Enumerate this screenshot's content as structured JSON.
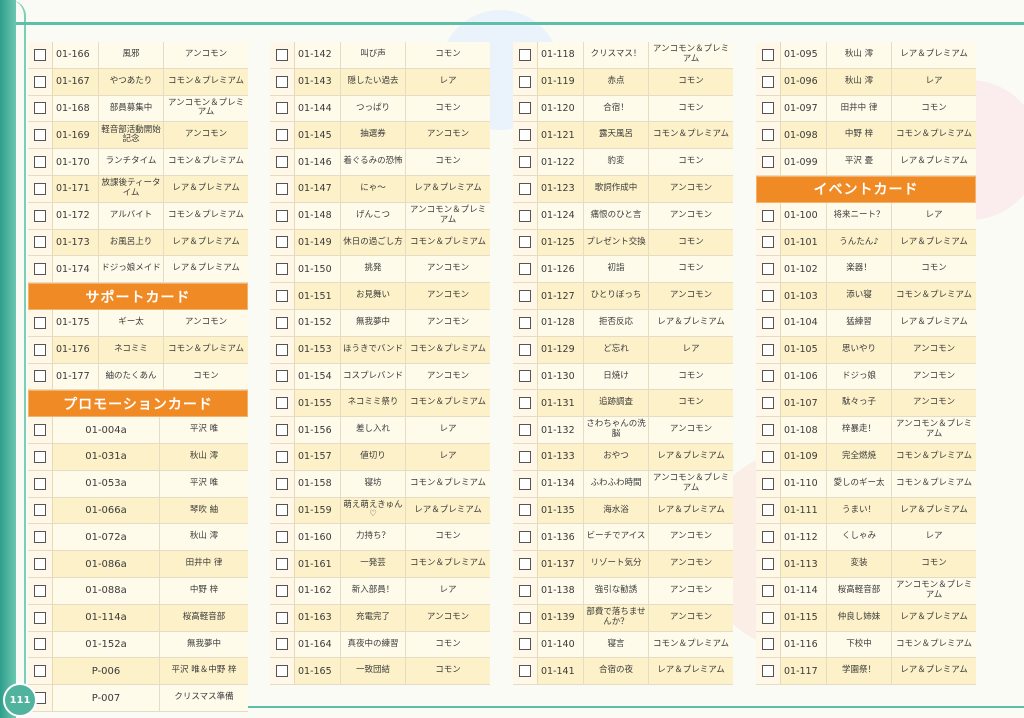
{
  "page_number": "111",
  "sections": {
    "support": "サポートカード",
    "promo": "プロモーションカード",
    "event": "イベントカード"
  },
  "col1": [
    {
      "num": "01-166",
      "name": "風邪",
      "rarity": "アンコモン"
    },
    {
      "num": "01-167",
      "name": "やつあたり",
      "rarity": "コモン＆プレミアム"
    },
    {
      "num": "01-168",
      "name": "部員募集中",
      "rarity": "アンコモン＆プレミアム"
    },
    {
      "num": "01-169",
      "name": "軽音部活動開始記念",
      "rarity": "アンコモン"
    },
    {
      "num": "01-170",
      "name": "ランチタイム",
      "rarity": "コモン＆プレミアム"
    },
    {
      "num": "01-171",
      "name": "放課後ティータイム",
      "rarity": "レア＆プレミアム"
    },
    {
      "num": "01-172",
      "name": "アルバイト",
      "rarity": "コモン＆プレミアム"
    },
    {
      "num": "01-173",
      "name": "お風呂上り",
      "rarity": "レア＆プレミアム"
    },
    {
      "num": "01-174",
      "name": "ドジっ娘メイド",
      "rarity": "レア＆プレミアム"
    }
  ],
  "col1_support": [
    {
      "num": "01-175",
      "name": "ギー太",
      "rarity": "アンコモン"
    },
    {
      "num": "01-176",
      "name": "ネコミミ",
      "rarity": "コモン＆プレミアム"
    },
    {
      "num": "01-177",
      "name": "紬のたくあん",
      "rarity": "コモン"
    }
  ],
  "col1_promo": [
    {
      "num": "01-004a",
      "name": "平沢 唯"
    },
    {
      "num": "01-031a",
      "name": "秋山 澪"
    },
    {
      "num": "01-053a",
      "name": "平沢 唯"
    },
    {
      "num": "01-066a",
      "name": "琴吹 紬"
    },
    {
      "num": "01-072a",
      "name": "秋山 澪"
    },
    {
      "num": "01-086a",
      "name": "田井中 律"
    },
    {
      "num": "01-088a",
      "name": "中野 梓"
    },
    {
      "num": "01-114a",
      "name": "桜高軽音部"
    },
    {
      "num": "01-152a",
      "name": "無我夢中"
    },
    {
      "num": "P-006",
      "name": "平沢 唯＆中野 梓"
    },
    {
      "num": "P-007",
      "name": "クリスマス準備"
    }
  ],
  "col2": [
    {
      "num": "01-142",
      "name": "叫び声",
      "rarity": "コモン"
    },
    {
      "num": "01-143",
      "name": "隠したい過去",
      "rarity": "レア"
    },
    {
      "num": "01-144",
      "name": "つっぱり",
      "rarity": "コモン"
    },
    {
      "num": "01-145",
      "name": "抽選券",
      "rarity": "アンコモン"
    },
    {
      "num": "01-146",
      "name": "着ぐるみの恐怖",
      "rarity": "コモン"
    },
    {
      "num": "01-147",
      "name": "にゃ～",
      "rarity": "レア＆プレミアム"
    },
    {
      "num": "01-148",
      "name": "げんこつ",
      "rarity": "アンコモン＆プレミアム"
    },
    {
      "num": "01-149",
      "name": "休日の過ごし方",
      "rarity": "コモン＆プレミアム"
    },
    {
      "num": "01-150",
      "name": "挑発",
      "rarity": "アンコモン"
    },
    {
      "num": "01-151",
      "name": "お見舞い",
      "rarity": "アンコモン"
    },
    {
      "num": "01-152",
      "name": "無我夢中",
      "rarity": "アンコモン"
    },
    {
      "num": "01-153",
      "name": "ほうきでバンド",
      "rarity": "コモン＆プレミアム"
    },
    {
      "num": "01-154",
      "name": "コスプレバンド",
      "rarity": "アンコモン"
    },
    {
      "num": "01-155",
      "name": "ネコミミ祭り",
      "rarity": "コモン＆プレミアム"
    },
    {
      "num": "01-156",
      "name": "差し入れ",
      "rarity": "レア"
    },
    {
      "num": "01-157",
      "name": "値切り",
      "rarity": "レア"
    },
    {
      "num": "01-158",
      "name": "寝坊",
      "rarity": "コモン＆プレミアム"
    },
    {
      "num": "01-159",
      "name": "萌え萌えきゅん♡",
      "rarity": "レア＆プレミアム"
    },
    {
      "num": "01-160",
      "name": "力持ち？",
      "rarity": "コモン"
    },
    {
      "num": "01-161",
      "name": "一発芸",
      "rarity": "コモン＆プレミアム"
    },
    {
      "num": "01-162",
      "name": "新入部員！",
      "rarity": "レア"
    },
    {
      "num": "01-163",
      "name": "充電完了",
      "rarity": "アンコモン"
    },
    {
      "num": "01-164",
      "name": "真夜中の練習",
      "rarity": "コモン"
    },
    {
      "num": "01-165",
      "name": "一致団結",
      "rarity": "コモン"
    }
  ],
  "col3": [
    {
      "num": "01-118",
      "name": "クリスマス！",
      "rarity": "アンコモン＆プレミアム"
    },
    {
      "num": "01-119",
      "name": "赤点",
      "rarity": "コモン"
    },
    {
      "num": "01-120",
      "name": "合宿！",
      "rarity": "コモン"
    },
    {
      "num": "01-121",
      "name": "露天風呂",
      "rarity": "コモン＆プレミアム"
    },
    {
      "num": "01-122",
      "name": "豹変",
      "rarity": "コモン"
    },
    {
      "num": "01-123",
      "name": "歌詞作成中",
      "rarity": "アンコモン"
    },
    {
      "num": "01-124",
      "name": "痛恨のひと言",
      "rarity": "アンコモン"
    },
    {
      "num": "01-125",
      "name": "プレゼント交換",
      "rarity": "コモン"
    },
    {
      "num": "01-126",
      "name": "初詣",
      "rarity": "コモン"
    },
    {
      "num": "01-127",
      "name": "ひとりぼっち",
      "rarity": "アンコモン"
    },
    {
      "num": "01-128",
      "name": "拒否反応",
      "rarity": "レア＆プレミアム"
    },
    {
      "num": "01-129",
      "name": "ど忘れ",
      "rarity": "レア"
    },
    {
      "num": "01-130",
      "name": "日焼け",
      "rarity": "コモン"
    },
    {
      "num": "01-131",
      "name": "追跡調査",
      "rarity": "コモン"
    },
    {
      "num": "01-132",
      "name": "さわちゃんの洗脳",
      "rarity": "アンコモン"
    },
    {
      "num": "01-133",
      "name": "おやつ",
      "rarity": "レア＆プレミアム"
    },
    {
      "num": "01-134",
      "name": "ふわふわ時間",
      "rarity": "アンコモン＆プレミアム"
    },
    {
      "num": "01-135",
      "name": "海水浴",
      "rarity": "レア＆プレミアム"
    },
    {
      "num": "01-136",
      "name": "ビーチでアイス",
      "rarity": "アンコモン"
    },
    {
      "num": "01-137",
      "name": "リゾート気分",
      "rarity": "アンコモン"
    },
    {
      "num": "01-138",
      "name": "強引な勧誘",
      "rarity": "アンコモン"
    },
    {
      "num": "01-139",
      "name": "部費で落ちませんか？",
      "rarity": "アンコモン"
    },
    {
      "num": "01-140",
      "name": "寝言",
      "rarity": "コモン＆プレミアム"
    },
    {
      "num": "01-141",
      "name": "合宿の夜",
      "rarity": "レア＆プレミアム"
    }
  ],
  "col4": [
    {
      "num": "01-095",
      "name": "秋山 澪",
      "rarity": "レア＆プレミアム"
    },
    {
      "num": "01-096",
      "name": "秋山 澪",
      "rarity": "レア"
    },
    {
      "num": "01-097",
      "name": "田井中 律",
      "rarity": "コモン"
    },
    {
      "num": "01-098",
      "name": "中野 梓",
      "rarity": "コモン＆プレミアム"
    },
    {
      "num": "01-099",
      "name": "平沢 憂",
      "rarity": "レア＆プレミアム"
    }
  ],
  "col4_event": [
    {
      "num": "01-100",
      "name": "将来ニート？",
      "rarity": "レア"
    },
    {
      "num": "01-101",
      "name": "うんたん♪",
      "rarity": "レア＆プレミアム"
    },
    {
      "num": "01-102",
      "name": "楽器！",
      "rarity": "コモン"
    },
    {
      "num": "01-103",
      "name": "添い寝",
      "rarity": "コモン＆プレミアム"
    },
    {
      "num": "01-104",
      "name": "猛練習",
      "rarity": "レア＆プレミアム"
    },
    {
      "num": "01-105",
      "name": "思いやり",
      "rarity": "アンコモン"
    },
    {
      "num": "01-106",
      "name": "ドジっ娘",
      "rarity": "アンコモン"
    },
    {
      "num": "01-107",
      "name": "駄々っ子",
      "rarity": "アンコモン"
    },
    {
      "num": "01-108",
      "name": "梓暴走！",
      "rarity": "アンコモン＆プレミアム"
    },
    {
      "num": "01-109",
      "name": "完全燃焼",
      "rarity": "コモン＆プレミアム"
    },
    {
      "num": "01-110",
      "name": "愛しのギー太",
      "rarity": "コモン＆プレミアム"
    },
    {
      "num": "01-111",
      "name": "うまい！",
      "rarity": "レア＆プレミアム"
    },
    {
      "num": "01-112",
      "name": "くしゃみ",
      "rarity": "レア"
    },
    {
      "num": "01-113",
      "name": "変装",
      "rarity": "コモン"
    },
    {
      "num": "01-114",
      "name": "桜高軽音部",
      "rarity": "アンコモン＆プレミアム"
    },
    {
      "num": "01-115",
      "name": "仲良し姉妹",
      "rarity": "レア＆プレミアム"
    },
    {
      "num": "01-116",
      "name": "下校中",
      "rarity": "コモン＆プレミアム"
    },
    {
      "num": "01-117",
      "name": "学園祭！",
      "rarity": "レア＆プレミアム"
    }
  ]
}
